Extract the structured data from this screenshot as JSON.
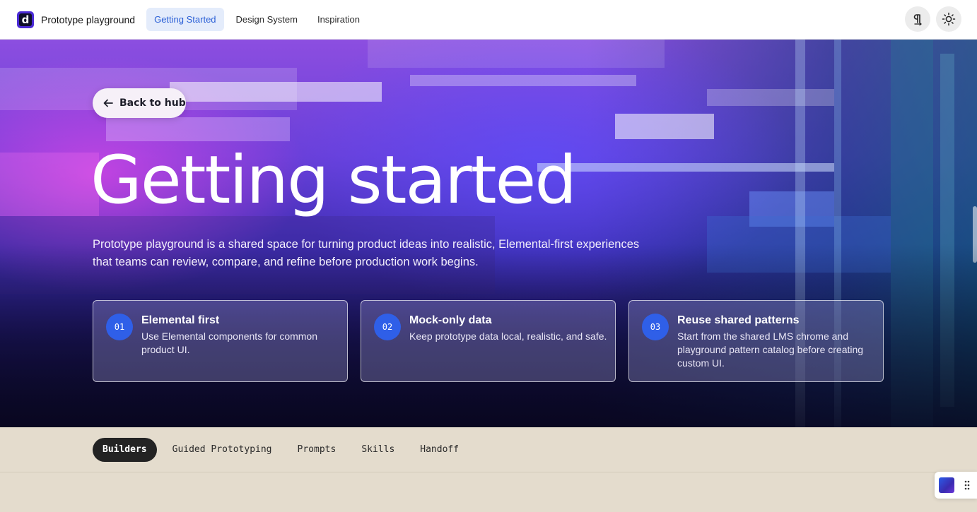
{
  "app": {
    "logo_letter": "d",
    "name": "Prototype playground"
  },
  "nav": {
    "items": [
      {
        "label": "Getting Started",
        "active": true
      },
      {
        "label": "Design System",
        "active": false
      },
      {
        "label": "Inspiration",
        "active": false
      }
    ]
  },
  "top_actions": {
    "icons": [
      "paragraph-icon",
      "sun-icon"
    ]
  },
  "hero": {
    "back_label": "Back to hub",
    "title": "Getting started",
    "description": "Prototype playground is a shared space for turning product ideas into realistic, Elemental-first experiences that teams can review, compare, and refine before production work begins.",
    "cards": [
      {
        "number": "01",
        "title": "Elemental first",
        "description": "Use Elemental components for common product UI."
      },
      {
        "number": "02",
        "title": "Mock-only data",
        "description": "Keep prototype data local, realistic, and safe."
      },
      {
        "number": "03",
        "title": "Reuse shared patterns",
        "description": "Start from the shared LMS chrome and playground pattern catalog before creating custom UI."
      }
    ]
  },
  "tabs": {
    "items": [
      {
        "label": "Builders",
        "active": true
      },
      {
        "label": "Guided Prototyping",
        "active": false
      },
      {
        "label": "Prompts",
        "active": false
      },
      {
        "label": "Skills",
        "active": false
      },
      {
        "label": "Handoff",
        "active": false
      }
    ]
  },
  "colors": {
    "accent": "#2a5fd6",
    "card_number_bg": "#2f5fe8",
    "tab_active_bg": "#232323",
    "page_bg": "#e4dccd"
  }
}
